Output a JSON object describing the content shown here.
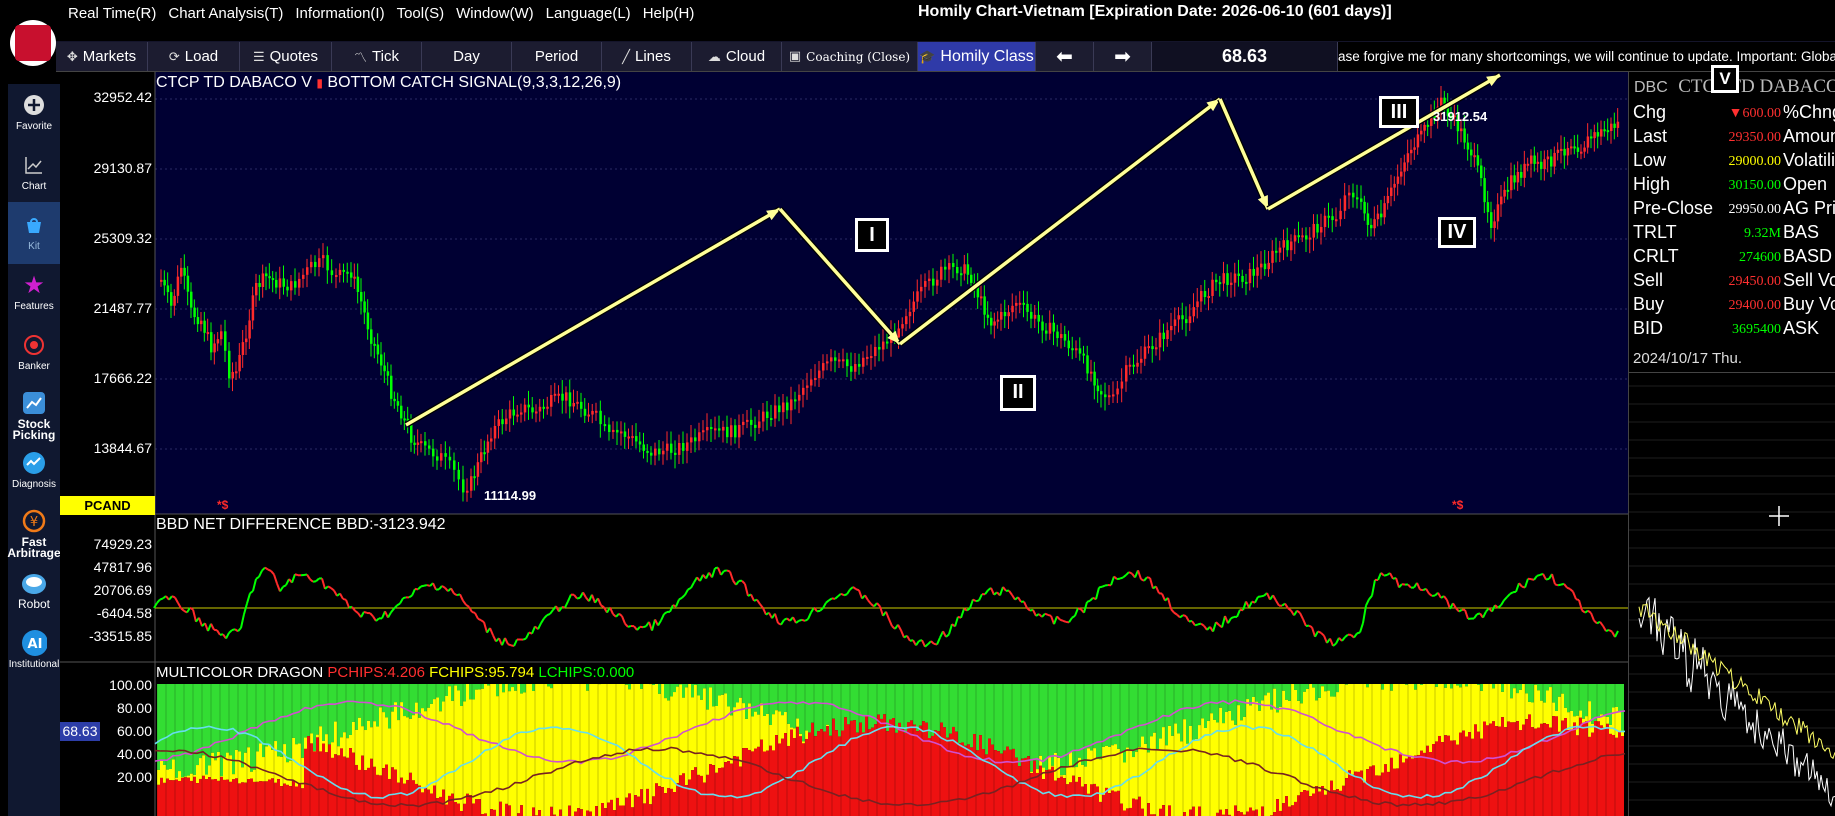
{
  "menu": [
    "Real Time(R)",
    "Chart Analysis(T)",
    "Information(I)",
    "Tool(S)",
    "Window(W)",
    "Language(L)",
    "Help(H)"
  ],
  "app_title": "Homily Chart-Vietnam  [Expiration Date: 2026-06-10 (601 days)]",
  "toolbar": {
    "markets": "Markets",
    "load": "Load",
    "quotes": "Quotes",
    "tick": "Tick",
    "day": "Day",
    "period": "Period",
    "lines": "Lines",
    "cloud": "Cloud",
    "coaching": "Coaching (Close)",
    "homily": "Homily Class",
    "value": "68.63"
  },
  "ticker_text": "ase forgive me for many shortcomings, we will continue to update. Important: Global Inde",
  "sidebar": [
    {
      "label": "Favorite",
      "icon": "plus-circle-icon"
    },
    {
      "label": "Chart",
      "icon": "chart-icon"
    },
    {
      "label": "Kit",
      "icon": "kit-bag-icon"
    },
    {
      "label": "Features",
      "icon": "star-icon"
    },
    {
      "label": "Banker",
      "icon": "target-icon"
    },
    {
      "label": "Stock Picking",
      "icon": "stock-picking-icon"
    },
    {
      "label": "Diagnosis",
      "icon": "diagnosis-icon"
    },
    {
      "label": "Fast Arbitrage",
      "icon": "arbitrage-icon"
    },
    {
      "label": "Robot",
      "icon": "robot-icon"
    },
    {
      "label": "Institutional",
      "icon": "ai-icon"
    }
  ],
  "main_chart": {
    "title": "CTCP TD DABACO V",
    "indicator": "BOTTOM CATCH SIGNAL(9,3,3,12,26,9)",
    "y_ticks": [
      "32952.42",
      "29130.87",
      "25309.32",
      "21487.77",
      "17666.22",
      "13844.67"
    ],
    "pcand": "PCAND",
    "signal_mark": "*$",
    "low_annotation": "11114.99",
    "high_annotation": "31912.54",
    "waves": [
      "I",
      "II",
      "III",
      "IV",
      "V"
    ]
  },
  "bbd": {
    "title": "BBD NET DIFFERENCE BBD:-3123.942",
    "y_ticks": [
      "74929.23",
      "47817.96",
      "20706.69",
      "-6404.58",
      "-33515.85"
    ]
  },
  "dragon": {
    "title": "MULTICOLOR DRAGON",
    "pchips": "PCHIPS:4.206",
    "fchips": "FCHIPS:95.794",
    "lchips": "LCHIPS:0.000",
    "y_ticks": [
      "100.00",
      "80.00",
      "60.00",
      "40.00",
      "20.00"
    ],
    "badge": "68.63"
  },
  "quote": {
    "code": "DBC",
    "name": "CTCP TD DABACO",
    "rows": [
      {
        "label": "Chg",
        "value": "▼600.00",
        "color": "#ff3030",
        "label2": "%Chng"
      },
      {
        "label": "Last",
        "value": "29350.00",
        "color": "#ff3030",
        "label2": "Amount"
      },
      {
        "label": "Low",
        "value": "29000.00",
        "color": "#ffff00",
        "label2": "Volatility"
      },
      {
        "label": "High",
        "value": "30150.00",
        "color": "#00ff00",
        "label2": "Open"
      },
      {
        "label": "Pre-Close",
        "value": "29950.00",
        "color": "#ffffff",
        "label2": "AG Price"
      },
      {
        "label": "TRLT",
        "value": "9.32M",
        "color": "#00ff00",
        "label2": "BAS"
      },
      {
        "label": "CRLT",
        "value": "274600",
        "color": "#00ff00",
        "label2": "BASD"
      },
      {
        "label": "Sell",
        "value": "29450.00",
        "color": "#ff3030",
        "label2": "Sell Vol"
      },
      {
        "label": "Buy",
        "value": "29400.00",
        "color": "#ff3030",
        "label2": "Buy Vol"
      },
      {
        "label": "BID",
        "value": "3695400",
        "color": "#00ff00",
        "label2": "ASK"
      }
    ],
    "date": "2024/10/17 Thu."
  },
  "colors": {
    "chart_bg": "#000033",
    "up": "#00ff00",
    "down": "#ff2a2a",
    "wave_line": "#ffff99",
    "dragon_yellow": "#ffff00",
    "dragon_green": "#33dd33",
    "dragon_red": "#ee1111"
  }
}
